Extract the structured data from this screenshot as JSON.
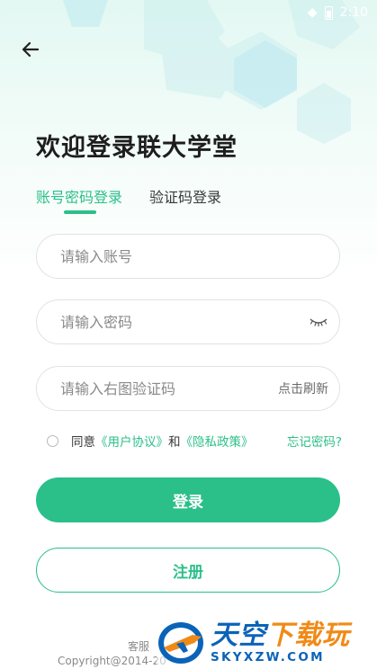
{
  "status_bar": {
    "time": "2:10"
  },
  "page": {
    "title": "欢迎登录联大学堂",
    "tabs": [
      {
        "label": "账号密码登录",
        "active": true
      },
      {
        "label": "验证码登录",
        "active": false
      }
    ]
  },
  "form": {
    "account_placeholder": "请输入账号",
    "password_placeholder": "请输入密码",
    "captcha_placeholder": "请输入右图验证码",
    "captcha_refresh": "点击刷新"
  },
  "agreement": {
    "prefix": "同意",
    "user_agreement": "《用户协议》",
    "conjunction": "和",
    "privacy_policy": "《隐私政策》",
    "forgot": "忘记密码?"
  },
  "buttons": {
    "login": "登录",
    "register": "注册"
  },
  "footer": {
    "service": "客服",
    "copyright": "Copyright@2014-20"
  },
  "watermark": {
    "cn_part1": "天空",
    "cn_part2": "下载玩",
    "en": "SKYXZW.COM"
  },
  "colors": {
    "accent": "#2bbf8a",
    "title_text": "#1e1e1e",
    "placeholder": "#8a8a8a"
  }
}
